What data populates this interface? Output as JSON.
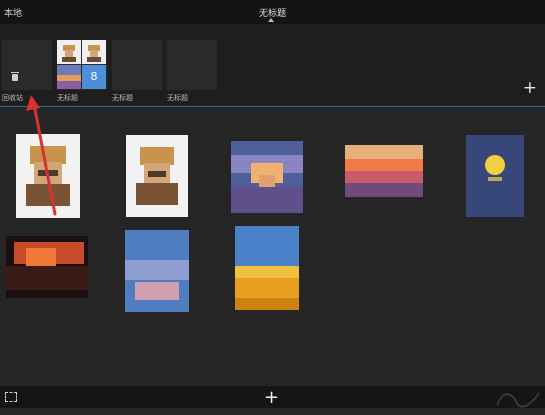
{
  "header": {
    "left_label": "本地",
    "title": "无标题"
  },
  "albums": [
    {
      "label": "回收站",
      "icon": "trash-icon"
    },
    {
      "label": "无标题",
      "count": "8"
    },
    {
      "label": "无标题"
    },
    {
      "label": "无标题"
    }
  ],
  "toolbar": {
    "add_album": "+",
    "add_photo": "+"
  },
  "colors": {
    "accent": "#4a8fd8",
    "divider": "#2e6fa8",
    "annotation_arrow": "#d93030"
  }
}
